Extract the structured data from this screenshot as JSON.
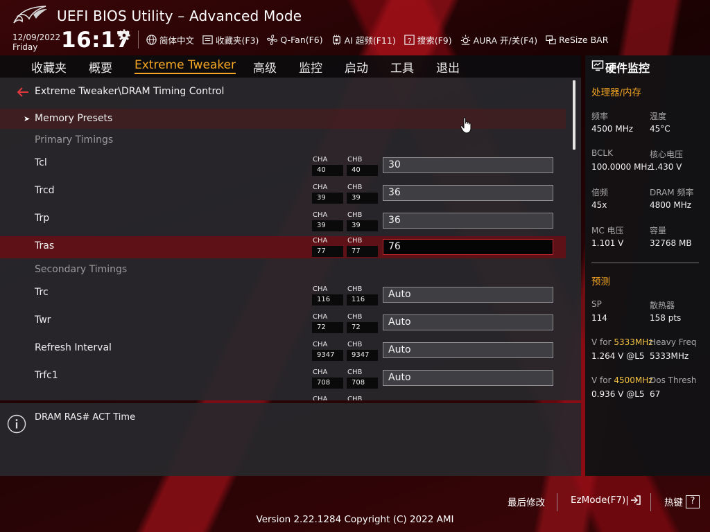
{
  "header": {
    "title": "UEFI BIOS Utility – Advanced Mode",
    "date": "12/09/2022",
    "day": "Friday",
    "time": "16:17",
    "toolbar": [
      {
        "label": "简体中文",
        "icon": "globe-icon"
      },
      {
        "label": "收藏夹(F3)",
        "icon": "favorites-icon"
      },
      {
        "label": "Q-Fan(F6)",
        "icon": "fan-icon"
      },
      {
        "label": "AI 超频(F11)",
        "icon": "ai-overclock-icon"
      },
      {
        "label": "搜索(F9)",
        "icon": "search-help-icon"
      },
      {
        "label": "AURA 开/关(F4)",
        "icon": "aura-light-icon"
      },
      {
        "label": "ReSize BAR",
        "icon": "resize-bar-icon"
      }
    ]
  },
  "nav": {
    "items": [
      "收藏夹",
      "概要",
      "Extreme Tweaker",
      "高级",
      "监控",
      "启动",
      "工具",
      "退出"
    ],
    "active_index": 2
  },
  "breadcrumb": "Extreme Tweaker\\DRAM Timing Control",
  "rows": {
    "memory_presets": "Memory Presets",
    "primary_header": "Primary Timings",
    "secondary_header": "Secondary Timings",
    "tcl": {
      "label": "Tcl",
      "cha": "40",
      "chb": "40",
      "value": "30"
    },
    "trcd": {
      "label": "Trcd",
      "cha": "39",
      "chb": "39",
      "value": "36"
    },
    "trp": {
      "label": "Trp",
      "cha": "39",
      "chb": "39",
      "value": "36"
    },
    "tras": {
      "label": "Tras",
      "cha": "77",
      "chb": "77",
      "value": "76"
    },
    "trc": {
      "label": "Trc",
      "cha": "116",
      "chb": "116",
      "value": "Auto"
    },
    "twr": {
      "label": "Twr",
      "cha": "72",
      "chb": "72",
      "value": "Auto"
    },
    "refresh": {
      "label": "Refresh Interval",
      "cha": "9347",
      "chb": "9347",
      "value": "Auto"
    },
    "trfc1": {
      "label": "Trfc1",
      "cha": "708",
      "chb": "708",
      "value": "Auto"
    }
  },
  "channel_labels": {
    "a": "CHA",
    "b": "CHB"
  },
  "help_text": "DRAM RAS# ACT Time",
  "monitor": {
    "title": "硬件监控",
    "cpu_mem_header": "处理器/内存",
    "freq_label": "频率",
    "freq_value": "4500 MHz",
    "temp_label": "温度",
    "temp_value": "45°C",
    "bclk_label": "BCLK",
    "bclk_value": "100.0000 MHz",
    "core_v_label": "核心电压",
    "core_v_value": "1.430 V",
    "ratio_label": "倍频",
    "ratio_value": "45x",
    "dram_freq_label": "DRAM 频率",
    "dram_freq_value": "4800 MHz",
    "mc_v_label": "MC 电压",
    "mc_v_value": "1.101 V",
    "capacity_label": "容量",
    "capacity_value": "32768 MB",
    "predict_header": "预测",
    "sp_label": "SP",
    "sp_value": "114",
    "cooler_label": "散热器",
    "cooler_value": "158 pts",
    "v_for_prefix": "V for",
    "v5333_freq": "5333MHz",
    "v5333_value": "1.264 V @L5",
    "heavy_label": "Heavy Freq",
    "heavy_value": "5333MHz",
    "v4500_freq": "4500MHz",
    "v4500_value": "0.936 V @L5",
    "dos_label": "Dos Thresh",
    "dos_value": "67"
  },
  "footer": {
    "last_modified": "最后修改",
    "ezmode": "EzMode(F7)|",
    "hotkeys": "热键",
    "hotkey_symbol": "?",
    "version": "Version 2.22.1284 Copyright (C) 2022 AMI"
  },
  "colors": {
    "accent": "#f5a623",
    "selected_row": "#5e1116",
    "active_border": "#c2262c"
  }
}
